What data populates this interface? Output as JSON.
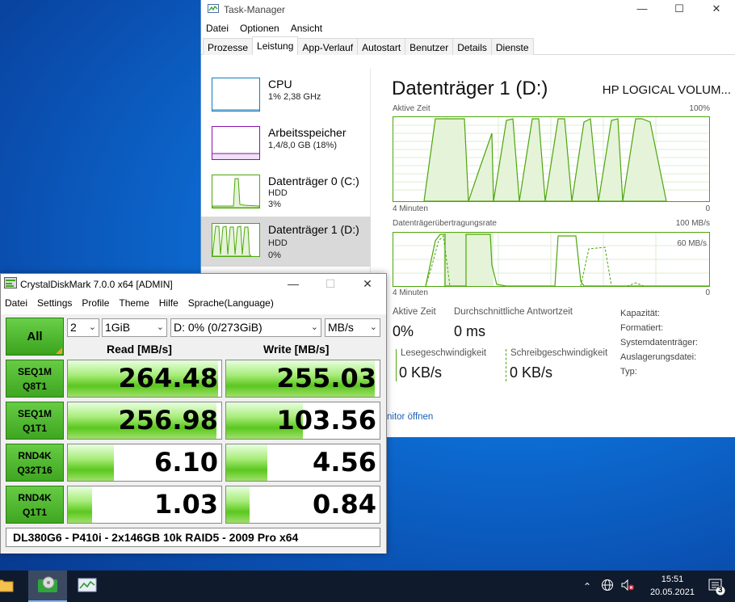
{
  "taskmanager": {
    "title": "Task-Manager",
    "menu": [
      "Datei",
      "Optionen",
      "Ansicht"
    ],
    "tabs": [
      "Prozesse",
      "Leistung",
      "App-Verlauf",
      "Autostart",
      "Benutzer",
      "Details",
      "Dienste"
    ],
    "sidebar": [
      {
        "name": "CPU",
        "sub1": "1% 2,38 GHz",
        "sub2": "",
        "color": "#117dbb"
      },
      {
        "name": "Arbeitsspeicher",
        "sub1": "1,4/8,0 GB (18%)",
        "sub2": "",
        "color": "#8b12ae"
      },
      {
        "name": "Datenträger 0 (C:)",
        "sub1": "HDD",
        "sub2": "3%",
        "color": "#4da60c"
      },
      {
        "name": "Datenträger 1 (D:)",
        "sub1": "HDD",
        "sub2": "0%",
        "color": "#4da60c"
      }
    ],
    "detail": {
      "title": "Datenträger 1 (D:)",
      "model": "HP LOGICAL VOLUM...",
      "graph1_label": "Aktive Zeit",
      "graph1_max": "100%",
      "graph1_left": "4 Minuten",
      "graph1_right": "0",
      "graph2_label": "Datenträgerübertragungsrate",
      "graph2_max": "100 MB/s",
      "graph2_mid": "60 MB/s",
      "graph2_left": "4 Minuten",
      "graph2_right": "0",
      "active_time_label": "Aktive Zeit",
      "active_time_value": "0%",
      "response_label": "Durchschnittliche Antwortzeit",
      "response_value": "0 ms",
      "read_label": "Lesegeschwindigkeit",
      "read_value": "0 KB/s",
      "write_label": "Schreibgeschwindigkeit",
      "write_value": "0 KB/s",
      "props": [
        "Kapazität:",
        "Formatiert:",
        "Systemdatenträger:",
        "Auslagerungsdatei:",
        "Typ:"
      ],
      "monitor_link": "nitor öffnen"
    }
  },
  "cdm": {
    "title": "CrystalDiskMark 7.0.0 x64 [ADMIN]",
    "menu": [
      "Datei",
      "Settings",
      "Profile",
      "Theme",
      "Hilfe",
      "Sprache(Language)"
    ],
    "all_label": "All",
    "count": "2",
    "size": "1GiB",
    "drive": "D: 0% (0/273GiB)",
    "unit": "MB/s",
    "read_header": "Read [MB/s]",
    "write_header": "Write [MB/s]",
    "rows": [
      {
        "l1": "SEQ1M",
        "l2": "Q8T1",
        "read": "264.48",
        "write": "255.03",
        "read_frac": 0.98,
        "write_frac": 0.97
      },
      {
        "l1": "SEQ1M",
        "l2": "Q1T1",
        "read": "256.98",
        "write": "103.56",
        "read_frac": 0.97,
        "write_frac": 0.5
      },
      {
        "l1": "RND4K",
        "l2": "Q32T16",
        "read": "6.10",
        "write": "4.56",
        "read_frac": 0.3,
        "write_frac": 0.27
      },
      {
        "l1": "RND4K",
        "l2": "Q1T1",
        "read": "1.03",
        "write": "0.84",
        "read_frac": 0.16,
        "write_frac": 0.15
      }
    ],
    "comment": "DL380G6 - P410i - 2x146GB 10k RAID5 - 2009 Pro x64"
  },
  "taskbar": {
    "time": "15:51",
    "date": "20.05.2021",
    "notifications": "3"
  }
}
